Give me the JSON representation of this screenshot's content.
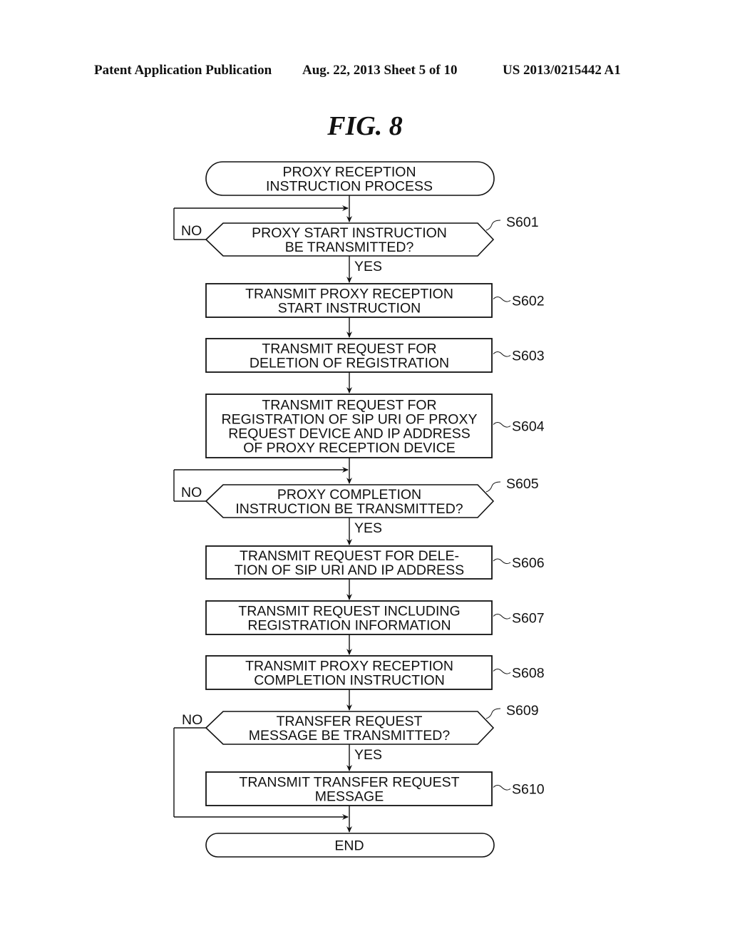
{
  "header": {
    "publication": "Patent Application Publication",
    "date_sheet": "Aug. 22, 2013  Sheet 5 of 10",
    "pub_number": "US 2013/0215442 A1"
  },
  "figure": {
    "title": "FIG. 8"
  },
  "flowchart": {
    "start": {
      "lines": [
        "PROXY RECEPTION",
        "INSTRUCTION PROCESS"
      ]
    },
    "end": {
      "lines": [
        "END"
      ]
    },
    "steps": [
      {
        "id": "S601",
        "type": "decision",
        "lines": [
          "PROXY START INSTRUCTION",
          "BE TRANSMITTED?"
        ],
        "no_label": "NO",
        "yes_label": "YES"
      },
      {
        "id": "S602",
        "type": "process",
        "lines": [
          "TRANSMIT PROXY RECEPTION",
          "START INSTRUCTION"
        ]
      },
      {
        "id": "S603",
        "type": "process",
        "lines": [
          "TRANSMIT REQUEST FOR",
          "DELETION OF REGISTRATION"
        ]
      },
      {
        "id": "S604",
        "type": "process",
        "lines": [
          "TRANSMIT REQUEST FOR",
          "REGISTRATION OF SIP URI OF PROXY",
          "REQUEST DEVICE AND IP ADDRESS",
          "OF PROXY RECEPTION DEVICE"
        ]
      },
      {
        "id": "S605",
        "type": "decision",
        "lines": [
          "PROXY COMPLETION",
          "INSTRUCTION BE TRANSMITTED?"
        ],
        "no_label": "NO",
        "yes_label": "YES"
      },
      {
        "id": "S606",
        "type": "process",
        "lines": [
          "TRANSMIT REQUEST FOR DELE-",
          "TION OF SIP URI AND IP ADDRESS"
        ]
      },
      {
        "id": "S607",
        "type": "process",
        "lines": [
          "TRANSMIT REQUEST INCLUDING",
          "REGISTRATION INFORMATION"
        ]
      },
      {
        "id": "S608",
        "type": "process",
        "lines": [
          "TRANSMIT PROXY RECEPTION",
          "COMPLETION INSTRUCTION"
        ]
      },
      {
        "id": "S609",
        "type": "decision",
        "lines": [
          "TRANSFER REQUEST",
          "MESSAGE BE TRANSMITTED?"
        ],
        "no_label": "NO",
        "yes_label": "YES"
      },
      {
        "id": "S610",
        "type": "process",
        "lines": [
          "TRANSMIT TRANSFER REQUEST",
          "MESSAGE"
        ]
      }
    ]
  }
}
